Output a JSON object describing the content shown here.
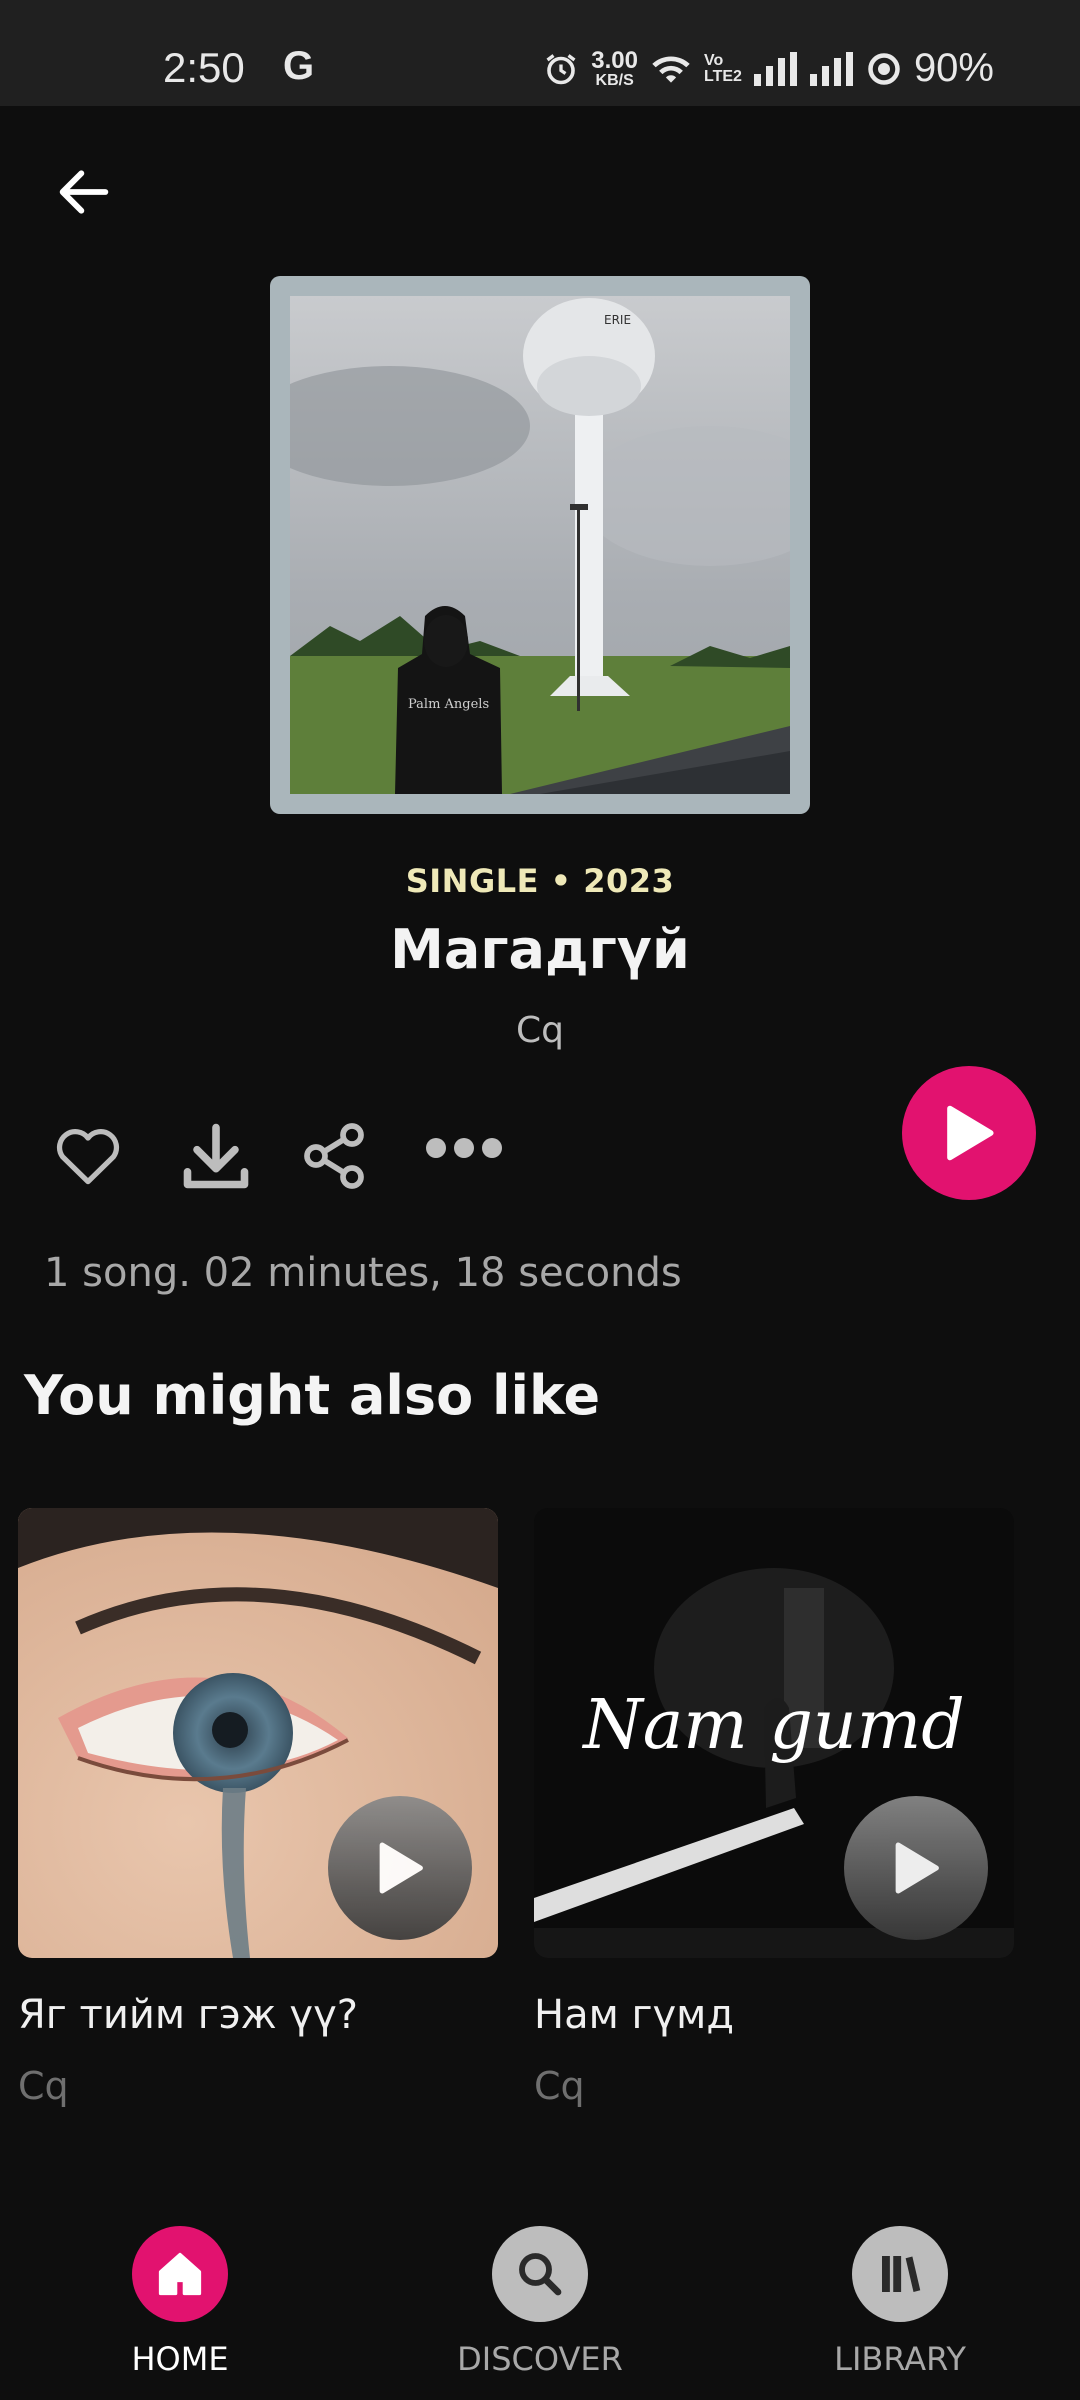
{
  "status_bar": {
    "time": "2:50",
    "g_label": "G",
    "net_speed_value": "3.00",
    "net_speed_unit": "KB/S",
    "volte_top": "Vo",
    "volte_bottom": "LTE2",
    "battery": "90%"
  },
  "release": {
    "type_year": "SINGLE • 2023",
    "title": "Магадгүй",
    "artist": "Cq",
    "summary": "1 song. 02 minutes, 18 seconds"
  },
  "recommendations": {
    "heading": "You might also like",
    "items": [
      {
        "title": "Яг тийм гэж үү?",
        "artist": "Cq"
      },
      {
        "title": "Нам гүмд",
        "artist": "Cq",
        "cover_text": "Nam gumd"
      }
    ]
  },
  "nav": {
    "items": [
      {
        "label": "HOME",
        "icon": "home-icon",
        "active": true
      },
      {
        "label": "DISCOVER",
        "icon": "search-icon",
        "active": false
      },
      {
        "label": "LIBRARY",
        "icon": "library-icon",
        "active": false
      }
    ]
  },
  "colors": {
    "accent": "#e2126f",
    "background": "#0e0e0e",
    "type_year": "#efe9b8"
  }
}
